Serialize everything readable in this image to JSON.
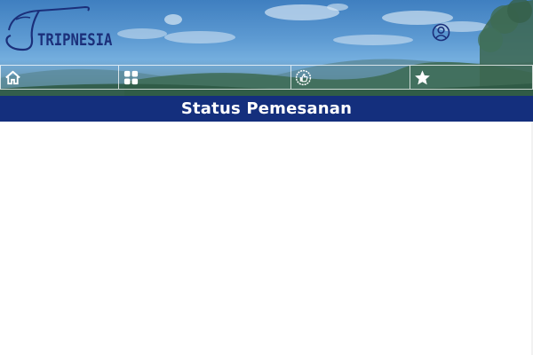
{
  "brand": {
    "name": "TRIPNESIA"
  },
  "header": {
    "user_icon": "user-circle-icon"
  },
  "nav": {
    "items": [
      {
        "icon": "home-icon"
      },
      {
        "icon": "grid-icon"
      },
      {
        "icon": "thumbs-up-badge-icon"
      },
      {
        "icon": "star-icon"
      }
    ]
  },
  "page": {
    "title": "Status Pemesanan"
  },
  "colors": {
    "title_bar": "#142f7d",
    "logo": "#1b2f7a",
    "title_text": "#ffffff"
  }
}
